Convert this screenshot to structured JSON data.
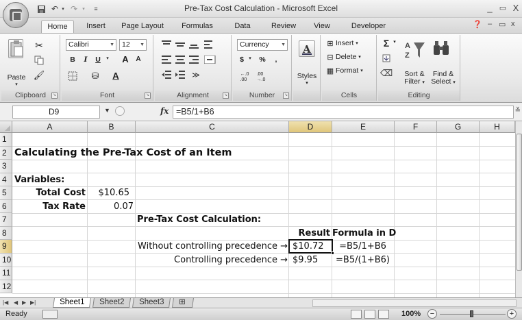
{
  "titlebar": {
    "title": "Pre-Tax Cost Calculation - Microsoft Excel",
    "window_controls": [
      "_",
      "▭",
      "X"
    ]
  },
  "ribbon_tabs": [
    "Home",
    "Insert",
    "Page Layout",
    "Formulas",
    "Data",
    "Review",
    "View",
    "Developer"
  ],
  "ribbon": {
    "clipboard": {
      "title": "Clipboard",
      "paste": "Paste"
    },
    "font": {
      "title": "Font",
      "name": "Calibri",
      "size": "12",
      "bold": "B",
      "italic": "I",
      "underline": "U",
      "grow": "A",
      "shrink": "A"
    },
    "alignment": {
      "title": "Alignment"
    },
    "number": {
      "title": "Number",
      "format": "Currency",
      "currency": "$",
      "percent": "%",
      "comma": ",",
      "inc_decimal": ".0 .00",
      "dec_decimal": ".00 ⇢.0"
    },
    "styles": {
      "title": "",
      "label": "Styles"
    },
    "cells": {
      "title": "Cells",
      "insert": "Insert",
      "delete": "Delete",
      "format": "Format"
    },
    "editing": {
      "title": "Editing",
      "sort": "Sort &",
      "filter": "Filter",
      "find": "Find &",
      "select": "Select"
    }
  },
  "formula_bar": {
    "name_box": "D9",
    "fx": "fx",
    "formula": "=B5/1+B6"
  },
  "columns": [
    "A",
    "B",
    "C",
    "D",
    "E",
    "F",
    "G",
    "H"
  ],
  "rows": [
    "1",
    "2",
    "3",
    "4",
    "5",
    "6",
    "7",
    "8",
    "9",
    "10",
    "11",
    "12"
  ],
  "cells": {
    "A2": "Calculating the Pre-Tax Cost of an Item",
    "A4": "Variables:",
    "A5": "Total Cost",
    "B5": "$10.65",
    "A6": "Tax Rate",
    "B6": "0.07",
    "C7": "Pre-Tax Cost Calculation:",
    "D8": "Result",
    "E8": "Formula in D",
    "C9": "Without controlling precedence →",
    "D9": "$10.72",
    "E9": "=B5/1+B6",
    "C10": "Controlling precedence →",
    "D10": "$9.95",
    "E10": "=B5/(1+B6)"
  },
  "sheet_tabs": [
    "Sheet1",
    "Sheet2",
    "Sheet3"
  ],
  "status": {
    "ready": "Ready",
    "zoom": "100%"
  }
}
